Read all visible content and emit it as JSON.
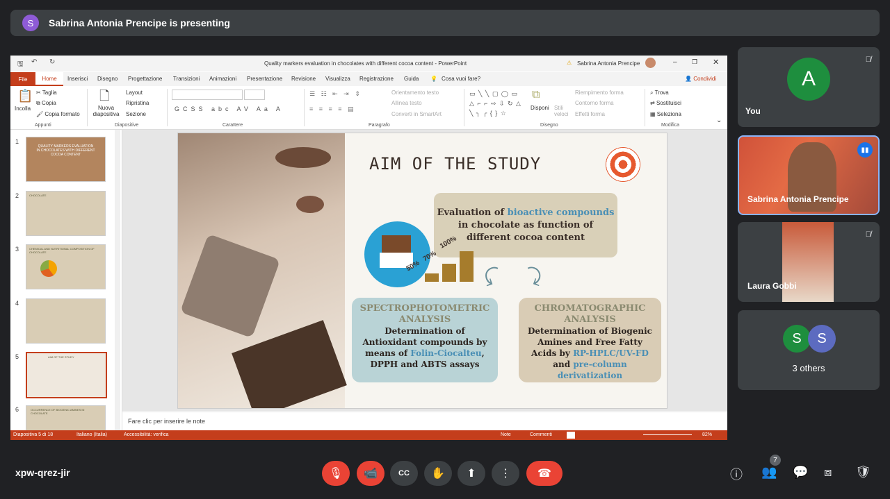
{
  "banner": {
    "avatar": "S",
    "text": "Sabrina Antonia Prencipe is presenting"
  },
  "ppt": {
    "window_title": "Quality markers evaluation in chocolates with different cocoa content  -  PowerPoint",
    "user": "Sabrina Antonia Prencipe",
    "tabs": [
      "File",
      "Home",
      "Inserisci",
      "Disegno",
      "Progettazione",
      "Transizioni",
      "Animazioni",
      "Presentazione",
      "Revisione",
      "Visualizza",
      "Registrazione",
      "Guida",
      "Cosa vuoi fare?"
    ],
    "share": "Condividi",
    "ribbon": {
      "paste": "Incolla",
      "cut": "Taglia",
      "copy": "Copia",
      "format_painter": "Copia formato",
      "group_clipboard": "Appunti",
      "new_slide": "Nuova diapositiva",
      "layout": "Layout",
      "reset": "Ripristina",
      "section": "Sezione",
      "group_slides": "Diapositive",
      "group_font": "Carattere",
      "group_paragraph": "Paragrafo",
      "text_direction": "Orientamento testo",
      "align_text": "Allinea testo",
      "smartart": "Converti in SmartArt",
      "arrange": "Disponi",
      "quick_styles": "Stili veloci",
      "fill": "Riempimento forma",
      "outline": "Contorno forma",
      "effects": "Effetti forma",
      "group_draw": "Disegno",
      "find": "Trova",
      "replace": "Sostituisci",
      "select": "Seleziona",
      "group_edit": "Modifica"
    },
    "thumbnails": [
      "1",
      "2",
      "3",
      "4",
      "5",
      "6"
    ],
    "thumb_texts": [
      "QUALITY MARKERS EVALUATION IN CHOCOLATES WITH DIFFERENT COCOA CONTENT",
      "CHOCOLATE",
      "CHEMICAL AND NUTRITIONAL COMPOSITION OF CHOCOLATE",
      "",
      "AIM OF THE STUDY",
      "OCCURRENCE OF BIOGENIC AMINES IN CHOCOLATE"
    ],
    "slide": {
      "title": "AIM OF THE STUDY",
      "box_main_a": "Evaluation of ",
      "box_main_b": "bioactive compounds",
      "box_main_c": "in chocolate as function of different cocoa content",
      "pct1": "50%",
      "pct2": "70%",
      "pct3": "100%",
      "left_head": "SPECTROPHOTOMETRIC ANALYSIS",
      "left_a": "Determination of Antioxidant compounds by means of ",
      "left_b": "Folin-Ciocalteu",
      "left_c": ", ",
      "left_d": "DPPH",
      "left_e": " and ",
      "left_f": "ABTS",
      "left_g": " assays",
      "right_head": "CHROMATOGRAPHIC ANALYSIS",
      "right_a": "Determination of Biogenic Amines and Free Fatty Acids by ",
      "right_b": "RP-HPLC/UV-FD",
      "right_c": " and ",
      "right_d": "pre-column derivatization"
    },
    "notes": "Fare clic per inserire le note",
    "status": {
      "slide": "Diapositiva 5 di 18",
      "lang": "Italiano (Italia)",
      "access": "Accessibilità: verifica",
      "notes": "Note",
      "comments": "Commenti",
      "zoom": "82%"
    }
  },
  "tiles": [
    {
      "name": "You",
      "avatar": "A",
      "color": "#1e8e3e"
    },
    {
      "name": "Sabrina Antonia Prencipe"
    },
    {
      "name": "Laura Gobbi"
    },
    {
      "name": "3 others",
      "avatars": [
        "S",
        "S"
      ],
      "colors": [
        "#1e8e3e",
        "#5c6bc0"
      ]
    }
  ],
  "bottom": {
    "meeting_code": "xpw-qrez-jir",
    "people_count": "7"
  }
}
